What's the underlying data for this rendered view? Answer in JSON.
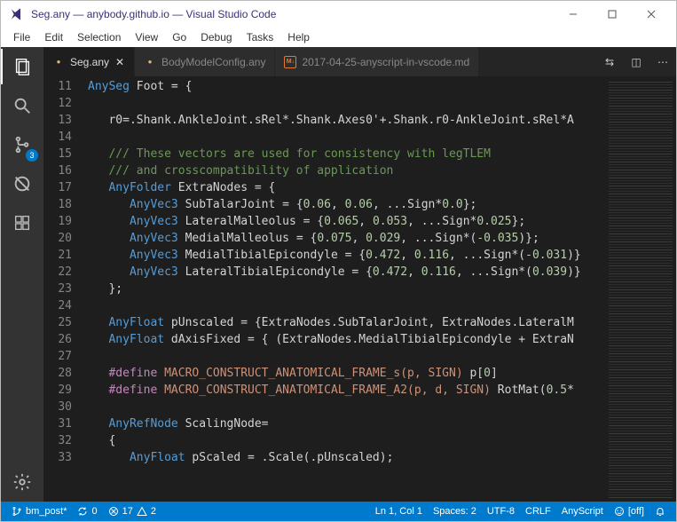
{
  "window_title": "Seg.any — anybody.github.io — Visual Studio Code",
  "menus": [
    "File",
    "Edit",
    "Selection",
    "View",
    "Go",
    "Debug",
    "Tasks",
    "Help"
  ],
  "activity": {
    "scm_badge": "3"
  },
  "tabs": [
    {
      "label": "Seg.any",
      "active": true,
      "dirty": true,
      "icon": "dot"
    },
    {
      "label": "BodyModelConfig.any",
      "active": false,
      "dirty": true,
      "icon": "dot"
    },
    {
      "label": "2017-04-25-anyscript-in-vscode.md",
      "active": false,
      "dirty": false,
      "icon": "md"
    }
  ],
  "line_start": 11,
  "code_lines": [
    [
      [
        "type",
        "AnySeg"
      ],
      [
        "",
        " Foot = {"
      ]
    ],
    [],
    [
      [
        "",
        "   r0=.Shank.AnkleJoint.sRel*.Shank.Axes0'+.Shank.r0-AnkleJoint.sRel*A"
      ]
    ],
    [],
    [
      [
        "comment",
        "   /// These vectors are used for consistency with legTLEM"
      ]
    ],
    [
      [
        "comment",
        "   /// and crosscompatibility of application"
      ]
    ],
    [
      [
        "",
        "   "
      ],
      [
        "type",
        "AnyFolder"
      ],
      [
        "",
        " ExtraNodes = {"
      ]
    ],
    [
      [
        "",
        "      "
      ],
      [
        "type",
        "AnyVec3"
      ],
      [
        "",
        " SubTalarJoint = {"
      ],
      [
        "number",
        "0.06"
      ],
      [
        "",
        ", "
      ],
      [
        "number",
        "0.06"
      ],
      [
        "",
        ", ...Sign*"
      ],
      [
        "number",
        "0.0"
      ],
      [
        "",
        "};"
      ]
    ],
    [
      [
        "",
        "      "
      ],
      [
        "type",
        "AnyVec3"
      ],
      [
        "",
        " LateralMalleolus = {"
      ],
      [
        "number",
        "0.065"
      ],
      [
        "",
        ", "
      ],
      [
        "number",
        "0.053"
      ],
      [
        "",
        ", ...Sign*"
      ],
      [
        "number",
        "0.025"
      ],
      [
        "",
        "};"
      ]
    ],
    [
      [
        "",
        "      "
      ],
      [
        "type",
        "AnyVec3"
      ],
      [
        "",
        " MedialMalleolus = {"
      ],
      [
        "number",
        "0.075"
      ],
      [
        "",
        ", "
      ],
      [
        "number",
        "0.029"
      ],
      [
        "",
        ", ...Sign*("
      ],
      [
        "number",
        "-0.035"
      ],
      [
        "",
        ")};"
      ]
    ],
    [
      [
        "",
        "      "
      ],
      [
        "type",
        "AnyVec3"
      ],
      [
        "",
        " MedialTibialEpicondyle = {"
      ],
      [
        "number",
        "0.472"
      ],
      [
        "",
        ", "
      ],
      [
        "number",
        "0.116"
      ],
      [
        "",
        ", ...Sign*("
      ],
      [
        "number",
        "-0.031"
      ],
      [
        "",
        ")}"
      ]
    ],
    [
      [
        "",
        "      "
      ],
      [
        "type",
        "AnyVec3"
      ],
      [
        "",
        " LateralTibialEpicondyle = {"
      ],
      [
        "number",
        "0.472"
      ],
      [
        "",
        ", "
      ],
      [
        "number",
        "0.116"
      ],
      [
        "",
        ", ...Sign*("
      ],
      [
        "number",
        "0.039"
      ],
      [
        "",
        ")}"
      ]
    ],
    [
      [
        "",
        "   };"
      ]
    ],
    [],
    [
      [
        "",
        "   "
      ],
      [
        "type",
        "AnyFloat"
      ],
      [
        "",
        " pUnscaled = {ExtraNodes.SubTalarJoint, ExtraNodes.LateralM"
      ]
    ],
    [
      [
        "",
        "   "
      ],
      [
        "type",
        "AnyFloat"
      ],
      [
        "",
        " dAxisFixed = { (ExtraNodes.MedialTibialEpicondyle + ExtraN"
      ]
    ],
    [],
    [
      [
        "",
        "   "
      ],
      [
        "define",
        "#define"
      ],
      [
        "",
        " "
      ],
      [
        "macro",
        "MACRO_CONSTRUCT_ANATOMICAL_FRAME_s(p, SIGN)"
      ],
      [
        "",
        " p["
      ],
      [
        "number",
        "0"
      ],
      [
        "",
        "]"
      ]
    ],
    [
      [
        "",
        "   "
      ],
      [
        "define",
        "#define"
      ],
      [
        "",
        " "
      ],
      [
        "macro",
        "MACRO_CONSTRUCT_ANATOMICAL_FRAME_A2(p, d, SIGN)"
      ],
      [
        "",
        " RotMat("
      ],
      [
        "number",
        "0.5"
      ],
      [
        "",
        "*"
      ]
    ],
    [],
    [
      [
        "",
        "   "
      ],
      [
        "type",
        "AnyRefNode"
      ],
      [
        "",
        " ScalingNode="
      ]
    ],
    [
      [
        "",
        "   {"
      ]
    ],
    [
      [
        "",
        "      "
      ],
      [
        "type",
        "AnyFloat"
      ],
      [
        "",
        " pScaled = .Scale(.pUnscaled);"
      ]
    ]
  ],
  "status": {
    "branch": "bm_post*",
    "sync": "0",
    "errors": "17",
    "warnings": "2",
    "position": "Ln 1, Col 1",
    "spaces": "Spaces: 2",
    "encoding": "UTF-8",
    "eol": "CRLF",
    "language": "AnyScript",
    "feedback": "[off]"
  }
}
